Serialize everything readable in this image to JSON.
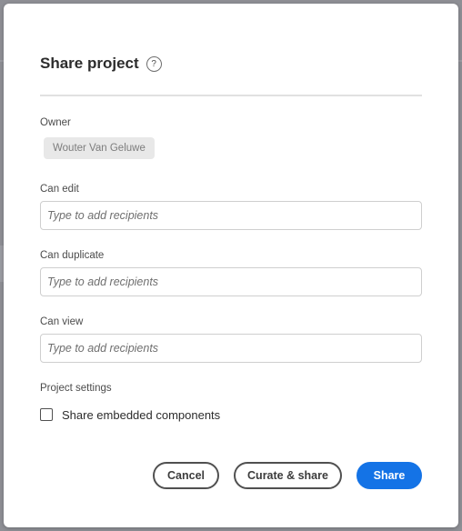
{
  "dialog": {
    "title": "Share project",
    "help_icon": "question-circle-icon",
    "help_glyph": "?"
  },
  "owner": {
    "label": "Owner",
    "name": "Wouter Van Geluwe"
  },
  "fields": [
    {
      "label": "Can edit",
      "placeholder": "Type to add recipients",
      "value": ""
    },
    {
      "label": "Can duplicate",
      "placeholder": "Type to add recipients",
      "value": ""
    },
    {
      "label": "Can view",
      "placeholder": "Type to add recipients",
      "value": ""
    }
  ],
  "settings": {
    "label": "Project settings",
    "share_embedded": {
      "label": "Share embedded components",
      "checked": false
    }
  },
  "buttons": {
    "cancel": "Cancel",
    "curate": "Curate & share",
    "share": "Share"
  },
  "colors": {
    "accent": "#1473e6",
    "backdrop": "#8e8f95"
  }
}
